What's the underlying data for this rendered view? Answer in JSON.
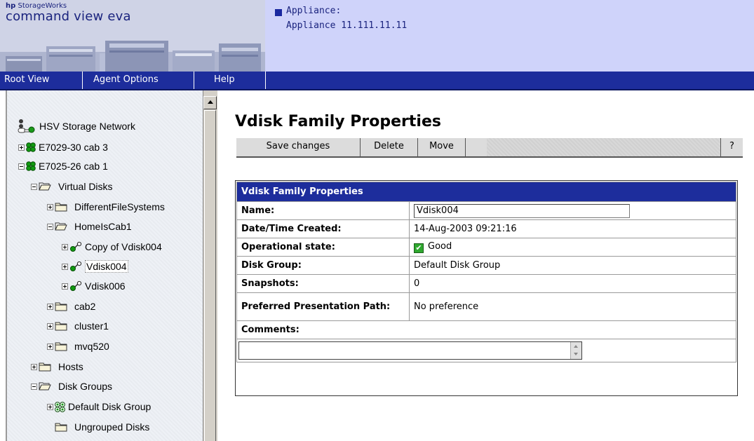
{
  "brand": {
    "company": "hp",
    "product_line": "StorageWorks",
    "product": "command view eva"
  },
  "appliance": {
    "label": "Appliance:",
    "name": "Appliance 11.111.11.11",
    "marker_color": "#1a28a0"
  },
  "menu": [
    {
      "label": "Root View"
    },
    {
      "label": "Agent Options"
    },
    {
      "label": "Help"
    }
  ],
  "tree": [
    {
      "label": "HSV Storage Network",
      "icon": "network-icon"
    },
    {
      "label": "E7029-30 cab 3",
      "icon": "storage-system-icon",
      "expander": "plus"
    },
    {
      "label": "E7025-26 cab 1",
      "icon": "storage-system-icon",
      "expander": "minus"
    },
    {
      "label": "Virtual Disks",
      "icon": "folder-open-icon",
      "expander": "minus"
    },
    {
      "label": "DifferentFileSystems",
      "icon": "folder-icon",
      "expander": "plus"
    },
    {
      "label": "HomeIsCab1",
      "icon": "folder-open-icon",
      "expander": "minus"
    },
    {
      "label": "Copy of Vdisk004",
      "icon": "vdisk-icon",
      "expander": "plus"
    },
    {
      "label": "Vdisk004",
      "icon": "vdisk-icon",
      "expander": "plus",
      "selected": true
    },
    {
      "label": "Vdisk006",
      "icon": "vdisk-icon",
      "expander": "plus"
    },
    {
      "label": "cab2",
      "icon": "folder-icon",
      "expander": "plus"
    },
    {
      "label": "cluster1",
      "icon": "folder-icon",
      "expander": "plus"
    },
    {
      "label": "mvq520",
      "icon": "folder-icon",
      "expander": "plus"
    },
    {
      "label": "Hosts",
      "icon": "folder-icon",
      "expander": "plus"
    },
    {
      "label": "Disk Groups",
      "icon": "folder-open-icon",
      "expander": "minus"
    },
    {
      "label": "Default Disk Group",
      "icon": "disk-group-icon",
      "expander": "plus"
    },
    {
      "label": "Ungrouped Disks",
      "icon": "folder-icon"
    }
  ],
  "page": {
    "title": "Vdisk Family Properties"
  },
  "toolbar": {
    "save_label": "Save changes",
    "delete_label": "Delete",
    "move_label": "Move",
    "help_label": "?"
  },
  "properties": {
    "header": "Vdisk Family Properties",
    "name_label": "Name:",
    "name_value": "Vdisk004",
    "created_label": "Date/Time Created:",
    "created_value": "14-Aug-2003 09:21:16",
    "state_label": "Operational state:",
    "state_value": "Good",
    "disk_group_label": "Disk Group:",
    "disk_group_value": "Default Disk Group",
    "snapshots_label": "Snapshots:",
    "snapshots_value": "0",
    "path_label": "Preferred Presentation Path:",
    "path_value": "No preference",
    "comments_label": "Comments:",
    "comments_value": ""
  },
  "colors": {
    "menubar": "#1d2d9c",
    "header_panel": "#cfd3fa",
    "table_header": "#1d2d9c",
    "status_good": "#2fa82f"
  }
}
